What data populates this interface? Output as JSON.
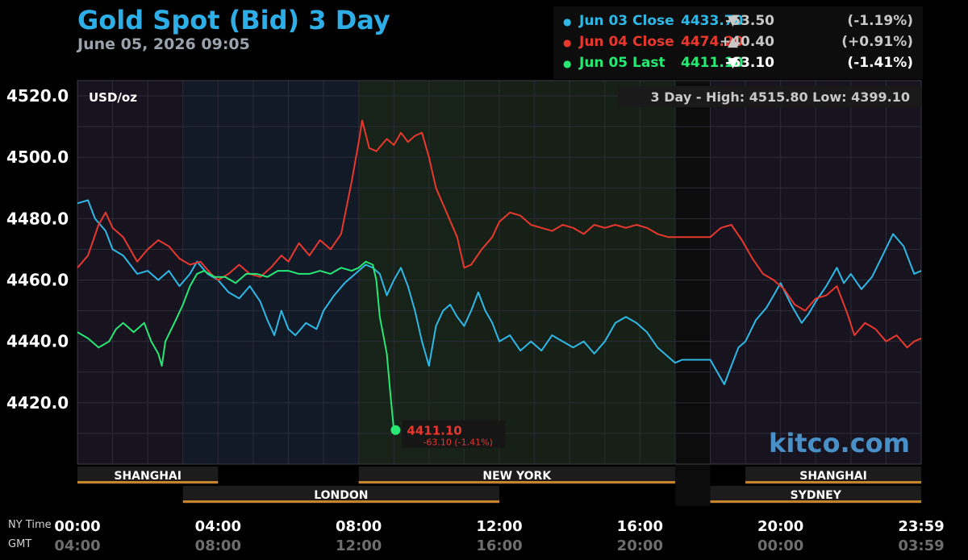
{
  "header": {
    "title": "Gold Spot (Bid) 3 Day",
    "subtitle": "June 05, 2026 09:05"
  },
  "legend": [
    {
      "dot": "●",
      "label": "Jun 03 Close",
      "value": "4433.70",
      "arrow": "▼",
      "change": "-53.50",
      "pct": "(-1.19%)",
      "color": "#2eb8e6"
    },
    {
      "dot": "●",
      "label": "Jun 04 Close",
      "value": "4474.20",
      "arrow": "▲",
      "change": "+40.40",
      "pct": "(+0.91%)",
      "color": "#e8382e"
    },
    {
      "dot": "●",
      "label": "Jun 05 Last",
      "value": "4411.10",
      "arrow": "▼",
      "change": "-63.10",
      "pct": "(-1.41%)",
      "color": "#27e873"
    }
  ],
  "chart_data": {
    "type": "line",
    "unit_label": "USD/oz",
    "range_note": "3 Day - High: 4515.80  Low: 4399.10",
    "watermark": "kitco.com",
    "ylim": [
      4400,
      4525
    ],
    "yticks": [
      "4520.0",
      "4500.0",
      "4480.0",
      "4460.0",
      "4440.0",
      "4420.0"
    ],
    "xticks_ny": [
      "00:00",
      "04:00",
      "08:00",
      "12:00",
      "16:00",
      "20:00",
      "23:59"
    ],
    "xticks_gmt": [
      "04:00",
      "08:00",
      "12:00",
      "16:00",
      "20:00",
      "00:00",
      "03:59"
    ],
    "x_axis_labels": {
      "ny": "NY Time",
      "gmt": "GMT"
    },
    "sessions": [
      {
        "name": "SHANGHAI",
        "start": 0,
        "end": 4
      },
      {
        "name": "LONDON",
        "start": 3,
        "end": 12
      },
      {
        "name": "NEW YORK",
        "start": 8,
        "end": 17
      },
      {
        "name": "SYDNEY",
        "start": 18,
        "end": 24
      },
      {
        "name": "SHANGHAI",
        "start": 19,
        "end": 24
      }
    ],
    "last_point": {
      "x": 9.05,
      "y": 4411.1,
      "label": "4411.10",
      "change": "-63.10 (-1.41%)"
    },
    "series": [
      {
        "name": "Jun 03 Close",
        "color": "#2eb8e6",
        "points": [
          [
            0,
            4485
          ],
          [
            0.3,
            4486
          ],
          [
            0.5,
            4480
          ],
          [
            0.8,
            4476
          ],
          [
            1.0,
            4470
          ],
          [
            1.3,
            4468
          ],
          [
            1.5,
            4465
          ],
          [
            1.7,
            4462
          ],
          [
            2.0,
            4463
          ],
          [
            2.3,
            4460
          ],
          [
            2.6,
            4463
          ],
          [
            2.9,
            4458
          ],
          [
            3.2,
            4462
          ],
          [
            3.4,
            4466
          ],
          [
            3.7,
            4462
          ],
          [
            4.0,
            4460
          ],
          [
            4.3,
            4456
          ],
          [
            4.6,
            4454
          ],
          [
            4.9,
            4458
          ],
          [
            5.2,
            4453
          ],
          [
            5.4,
            4447
          ],
          [
            5.6,
            4442
          ],
          [
            5.8,
            4450
          ],
          [
            6.0,
            4444
          ],
          [
            6.2,
            4442
          ],
          [
            6.5,
            4446
          ],
          [
            6.8,
            4444
          ],
          [
            7.0,
            4450
          ],
          [
            7.3,
            4455
          ],
          [
            7.6,
            4459
          ],
          [
            7.9,
            4462
          ],
          [
            8.2,
            4465
          ],
          [
            8.4,
            4464
          ],
          [
            8.6,
            4462
          ],
          [
            8.8,
            4455
          ],
          [
            9.0,
            4460
          ],
          [
            9.2,
            4464
          ],
          [
            9.4,
            4458
          ],
          [
            9.6,
            4450
          ],
          [
            9.8,
            4440
          ],
          [
            10.0,
            4432
          ],
          [
            10.2,
            4445
          ],
          [
            10.4,
            4450
          ],
          [
            10.6,
            4452
          ],
          [
            10.8,
            4448
          ],
          [
            11.0,
            4445
          ],
          [
            11.2,
            4450
          ],
          [
            11.4,
            4456
          ],
          [
            11.6,
            4450
          ],
          [
            11.8,
            4446
          ],
          [
            12.0,
            4440
          ],
          [
            12.3,
            4442
          ],
          [
            12.6,
            4437
          ],
          [
            12.9,
            4440
          ],
          [
            13.2,
            4437
          ],
          [
            13.5,
            4442
          ],
          [
            13.8,
            4440
          ],
          [
            14.1,
            4438
          ],
          [
            14.4,
            4440
          ],
          [
            14.7,
            4436
          ],
          [
            15.0,
            4440
          ],
          [
            15.3,
            4446
          ],
          [
            15.6,
            4448
          ],
          [
            15.9,
            4446
          ],
          [
            16.2,
            4443
          ],
          [
            16.5,
            4438
          ],
          [
            16.8,
            4435
          ],
          [
            17.0,
            4433
          ],
          [
            17.2,
            4434
          ],
          [
            17.5,
            4434
          ],
          [
            17.8,
            4434
          ],
          [
            18.0,
            4434
          ],
          [
            18.2,
            4430
          ],
          [
            18.4,
            4426
          ],
          [
            18.6,
            4432
          ],
          [
            18.8,
            4438
          ],
          [
            19.0,
            4440
          ],
          [
            19.3,
            4447
          ],
          [
            19.6,
            4451
          ],
          [
            19.8,
            4455
          ],
          [
            20.0,
            4459
          ],
          [
            20.3,
            4452
          ],
          [
            20.6,
            4446
          ],
          [
            20.8,
            4449
          ],
          [
            21.0,
            4453
          ],
          [
            21.3,
            4458
          ],
          [
            21.6,
            4464
          ],
          [
            21.8,
            4459
          ],
          [
            22.0,
            4462
          ],
          [
            22.3,
            4457
          ],
          [
            22.6,
            4461
          ],
          [
            22.9,
            4468
          ],
          [
            23.2,
            4475
          ],
          [
            23.5,
            4471
          ],
          [
            23.8,
            4462
          ],
          [
            24.0,
            4463
          ]
        ]
      },
      {
        "name": "Jun 04 Close",
        "color": "#e8382e",
        "points": [
          [
            0,
            4464
          ],
          [
            0.3,
            4468
          ],
          [
            0.6,
            4478
          ],
          [
            0.8,
            4482
          ],
          [
            1.0,
            4477
          ],
          [
            1.3,
            4474
          ],
          [
            1.5,
            4470
          ],
          [
            1.7,
            4466
          ],
          [
            2.0,
            4470
          ],
          [
            2.3,
            4473
          ],
          [
            2.6,
            4471
          ],
          [
            2.9,
            4467
          ],
          [
            3.2,
            4465
          ],
          [
            3.5,
            4466
          ],
          [
            3.8,
            4462
          ],
          [
            4.0,
            4460
          ],
          [
            4.3,
            4462
          ],
          [
            4.6,
            4465
          ],
          [
            4.9,
            4462
          ],
          [
            5.2,
            4461
          ],
          [
            5.5,
            4464
          ],
          [
            5.8,
            4468
          ],
          [
            6.0,
            4466
          ],
          [
            6.3,
            4472
          ],
          [
            6.6,
            4468
          ],
          [
            6.9,
            4473
          ],
          [
            7.2,
            4470
          ],
          [
            7.5,
            4475
          ],
          [
            7.8,
            4492
          ],
          [
            8.0,
            4505
          ],
          [
            8.1,
            4512
          ],
          [
            8.3,
            4503
          ],
          [
            8.5,
            4502
          ],
          [
            8.8,
            4506
          ],
          [
            9.0,
            4504
          ],
          [
            9.2,
            4508
          ],
          [
            9.4,
            4505
          ],
          [
            9.6,
            4507
          ],
          [
            9.8,
            4508
          ],
          [
            10.0,
            4500
          ],
          [
            10.2,
            4490
          ],
          [
            10.5,
            4482
          ],
          [
            10.8,
            4474
          ],
          [
            11.0,
            4464
          ],
          [
            11.2,
            4465
          ],
          [
            11.5,
            4470
          ],
          [
            11.8,
            4474
          ],
          [
            12.0,
            4479
          ],
          [
            12.3,
            4482
          ],
          [
            12.6,
            4481
          ],
          [
            12.9,
            4478
          ],
          [
            13.2,
            4477
          ],
          [
            13.5,
            4476
          ],
          [
            13.8,
            4478
          ],
          [
            14.1,
            4477
          ],
          [
            14.4,
            4475
          ],
          [
            14.7,
            4478
          ],
          [
            15.0,
            4477
          ],
          [
            15.3,
            4478
          ],
          [
            15.6,
            4477
          ],
          [
            15.9,
            4478
          ],
          [
            16.2,
            4477
          ],
          [
            16.5,
            4475
          ],
          [
            16.8,
            4474
          ],
          [
            17.0,
            4474
          ],
          [
            17.3,
            4474
          ],
          [
            17.6,
            4474
          ],
          [
            18.0,
            4474
          ],
          [
            18.3,
            4477
          ],
          [
            18.6,
            4478
          ],
          [
            18.9,
            4473
          ],
          [
            19.2,
            4467
          ],
          [
            19.5,
            4462
          ],
          [
            19.8,
            4460
          ],
          [
            20.1,
            4457
          ],
          [
            20.4,
            4452
          ],
          [
            20.7,
            4450
          ],
          [
            21.0,
            4454
          ],
          [
            21.3,
            4455
          ],
          [
            21.6,
            4458
          ],
          [
            21.9,
            4449
          ],
          [
            22.1,
            4442
          ],
          [
            22.4,
            4446
          ],
          [
            22.7,
            4444
          ],
          [
            23.0,
            4440
          ],
          [
            23.3,
            4442
          ],
          [
            23.6,
            4438
          ],
          [
            23.8,
            4440
          ],
          [
            24.0,
            4441
          ]
        ]
      },
      {
        "name": "Jun 05 Last",
        "color": "#27e873",
        "points": [
          [
            0,
            4443
          ],
          [
            0.3,
            4441
          ],
          [
            0.6,
            4438
          ],
          [
            0.9,
            4440
          ],
          [
            1.1,
            4444
          ],
          [
            1.3,
            4446
          ],
          [
            1.6,
            4443
          ],
          [
            1.9,
            4446
          ],
          [
            2.1,
            4440
          ],
          [
            2.3,
            4436
          ],
          [
            2.4,
            4432
          ],
          [
            2.5,
            4440
          ],
          [
            2.8,
            4447
          ],
          [
            3.0,
            4452
          ],
          [
            3.2,
            4458
          ],
          [
            3.4,
            4462
          ],
          [
            3.6,
            4463
          ],
          [
            3.9,
            4461
          ],
          [
            4.2,
            4461
          ],
          [
            4.5,
            4459
          ],
          [
            4.8,
            4462
          ],
          [
            5.1,
            4462
          ],
          [
            5.4,
            4461
          ],
          [
            5.7,
            4463
          ],
          [
            6.0,
            4463
          ],
          [
            6.3,
            4462
          ],
          [
            6.6,
            4462
          ],
          [
            6.9,
            4463
          ],
          [
            7.2,
            4462
          ],
          [
            7.5,
            4464
          ],
          [
            7.8,
            4463
          ],
          [
            8.0,
            4464
          ],
          [
            8.2,
            4466
          ],
          [
            8.4,
            4465
          ],
          [
            8.5,
            4460
          ],
          [
            8.6,
            4448
          ],
          [
            8.7,
            4442
          ],
          [
            8.8,
            4436
          ],
          [
            8.9,
            4423
          ],
          [
            9.0,
            4411
          ],
          [
            9.05,
            4411.1
          ]
        ]
      }
    ]
  }
}
